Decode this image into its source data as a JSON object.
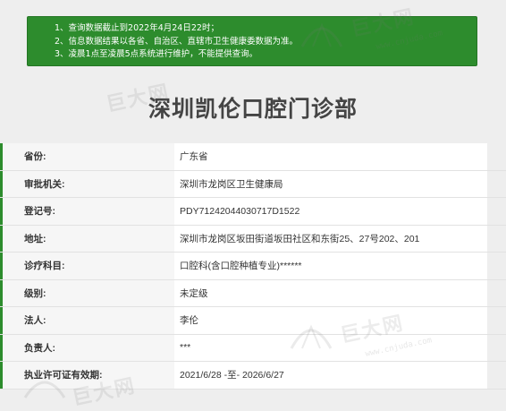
{
  "notice": {
    "lines": [
      "1、查询数据截止到2022年4月24日22时；",
      "2、信息数据结果以各省、自治区、直辖市卫生健康委数据为准。",
      "3、凌晨1点至凌晨5点系统进行维护，不能提供查询。"
    ]
  },
  "clinic": {
    "title": "深圳凯伦口腔门诊部"
  },
  "fields": [
    {
      "label": "省份:",
      "value": "广东省"
    },
    {
      "label": "审批机关:",
      "value": "深圳市龙岗区卫生健康局"
    },
    {
      "label": "登记号:",
      "value": "PDY71242044030717D1522"
    },
    {
      "label": "地址:",
      "value": "深圳市龙岗区坂田街道坂田社区和东街25、27号202、201"
    },
    {
      "label": "诊疗科目:",
      "value": "口腔科(含口腔种植专业)******"
    },
    {
      "label": "级别:",
      "value": "未定级"
    },
    {
      "label": "法人:",
      "value": "李伦"
    },
    {
      "label": "负责人:",
      "value": "***"
    },
    {
      "label": "执业许可证有效期:",
      "value": "2021/6/28 -至- 2026/6/27"
    }
  ],
  "watermark": {
    "brand": "巨大网",
    "site": "www.cnjuda.com"
  },
  "colors": {
    "accent": "#2d8c2d",
    "label_bg": "#f6f6f6",
    "page_bg": "#eeeeee"
  }
}
